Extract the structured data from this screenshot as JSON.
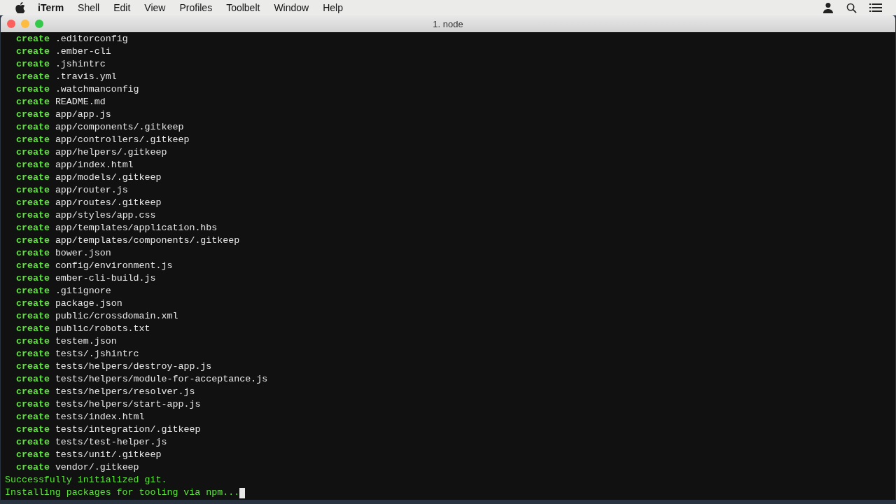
{
  "menu_bar": {
    "app_name": "iTerm",
    "items": [
      "Shell",
      "Edit",
      "View",
      "Profiles",
      "Toolbelt",
      "Window",
      "Help"
    ]
  },
  "window": {
    "title": "1. node"
  },
  "terminal": {
    "lines": [
      {
        "kind": "create",
        "verb": "create",
        "path": ".editorconfig"
      },
      {
        "kind": "create",
        "verb": "create",
        "path": ".ember-cli"
      },
      {
        "kind": "create",
        "verb": "create",
        "path": ".jshintrc"
      },
      {
        "kind": "create",
        "verb": "create",
        "path": ".travis.yml"
      },
      {
        "kind": "create",
        "verb": "create",
        "path": ".watchmanconfig"
      },
      {
        "kind": "create",
        "verb": "create",
        "path": "README.md"
      },
      {
        "kind": "create",
        "verb": "create",
        "path": "app/app.js"
      },
      {
        "kind": "create",
        "verb": "create",
        "path": "app/components/.gitkeep"
      },
      {
        "kind": "create",
        "verb": "create",
        "path": "app/controllers/.gitkeep"
      },
      {
        "kind": "create",
        "verb": "create",
        "path": "app/helpers/.gitkeep"
      },
      {
        "kind": "create",
        "verb": "create",
        "path": "app/index.html"
      },
      {
        "kind": "create",
        "verb": "create",
        "path": "app/models/.gitkeep"
      },
      {
        "kind": "create",
        "verb": "create",
        "path": "app/router.js"
      },
      {
        "kind": "create",
        "verb": "create",
        "path": "app/routes/.gitkeep"
      },
      {
        "kind": "create",
        "verb": "create",
        "path": "app/styles/app.css"
      },
      {
        "kind": "create",
        "verb": "create",
        "path": "app/templates/application.hbs"
      },
      {
        "kind": "create",
        "verb": "create",
        "path": "app/templates/components/.gitkeep"
      },
      {
        "kind": "create",
        "verb": "create",
        "path": "bower.json"
      },
      {
        "kind": "create",
        "verb": "create",
        "path": "config/environment.js"
      },
      {
        "kind": "create",
        "verb": "create",
        "path": "ember-cli-build.js"
      },
      {
        "kind": "create",
        "verb": "create",
        "path": ".gitignore"
      },
      {
        "kind": "create",
        "verb": "create",
        "path": "package.json"
      },
      {
        "kind": "create",
        "verb": "create",
        "path": "public/crossdomain.xml"
      },
      {
        "kind": "create",
        "verb": "create",
        "path": "public/robots.txt"
      },
      {
        "kind": "create",
        "verb": "create",
        "path": "testem.json"
      },
      {
        "kind": "create",
        "verb": "create",
        "path": "tests/.jshintrc"
      },
      {
        "kind": "create",
        "verb": "create",
        "path": "tests/helpers/destroy-app.js"
      },
      {
        "kind": "create",
        "verb": "create",
        "path": "tests/helpers/module-for-acceptance.js"
      },
      {
        "kind": "create",
        "verb": "create",
        "path": "tests/helpers/resolver.js"
      },
      {
        "kind": "create",
        "verb": "create",
        "path": "tests/helpers/start-app.js"
      },
      {
        "kind": "create",
        "verb": "create",
        "path": "tests/index.html"
      },
      {
        "kind": "create",
        "verb": "create",
        "path": "tests/integration/.gitkeep"
      },
      {
        "kind": "create",
        "verb": "create",
        "path": "tests/test-helper.js"
      },
      {
        "kind": "create",
        "verb": "create",
        "path": "tests/unit/.gitkeep"
      },
      {
        "kind": "create",
        "verb": "create",
        "path": "vendor/.gitkeep"
      },
      {
        "kind": "message",
        "text": "Successfully initialized git."
      },
      {
        "kind": "message",
        "text": "Installing packages for tooling via npm..."
      }
    ]
  }
}
